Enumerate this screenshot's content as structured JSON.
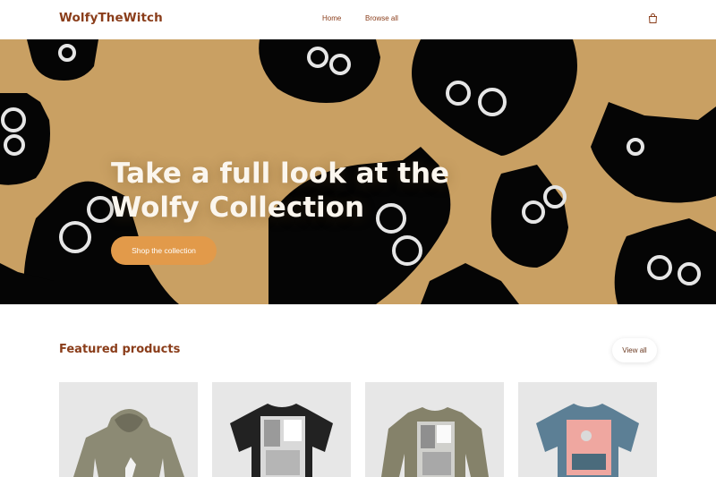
{
  "header": {
    "logo": "WolfyTheWitch",
    "nav": [
      {
        "label": "Home"
      },
      {
        "label": "Browse all"
      }
    ],
    "cart_icon": "shopping-bag-icon"
  },
  "hero": {
    "title_line1": "Take a full look at the",
    "title_line2": "Wolfy Collection",
    "cta_label": "Shop the collection",
    "background_color": "#c9a063",
    "cta_color": "#e29a4a"
  },
  "featured": {
    "title": "Featured products",
    "view_all_label": "View all",
    "products": [
      {
        "image": "olive-hoodie-with-cat-print",
        "color": "#8c8a74"
      },
      {
        "image": "black-tshirt-with-illustration",
        "color": "#222222"
      },
      {
        "image": "olive-sweatshirt-with-illustration",
        "color": "#85826a"
      },
      {
        "image": "blue-tshirt-with-pink-print",
        "color": "#5c7f95"
      }
    ]
  },
  "colors": {
    "brand": "#8a3d1a",
    "accent": "#e29a4a"
  }
}
